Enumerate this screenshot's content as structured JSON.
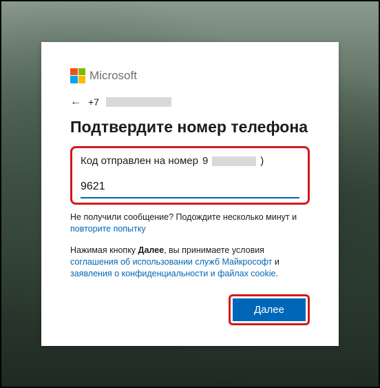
{
  "brand": "Microsoft",
  "back": {
    "arrow": "←",
    "phone_prefix": "+7"
  },
  "title": "Подтвердите номер телефона",
  "sent_label_prefix": "Код отправлен на номер",
  "sent_last_char": ")",
  "code_value": "9621",
  "hint_text": "Не получили сообщение? Подождите несколько минут и ",
  "hint_link": "повторите попытку",
  "terms_prefix": "Нажимая кнопку ",
  "terms_bold": "Далее",
  "terms_mid": ", вы принимаете условия ",
  "terms_link1": "соглашения об использовании служб Майкрософт",
  "terms_and": " и ",
  "terms_link2": "заявления о конфиденциальности и файлах cookie",
  "terms_period": ".",
  "next_label": "Далее"
}
